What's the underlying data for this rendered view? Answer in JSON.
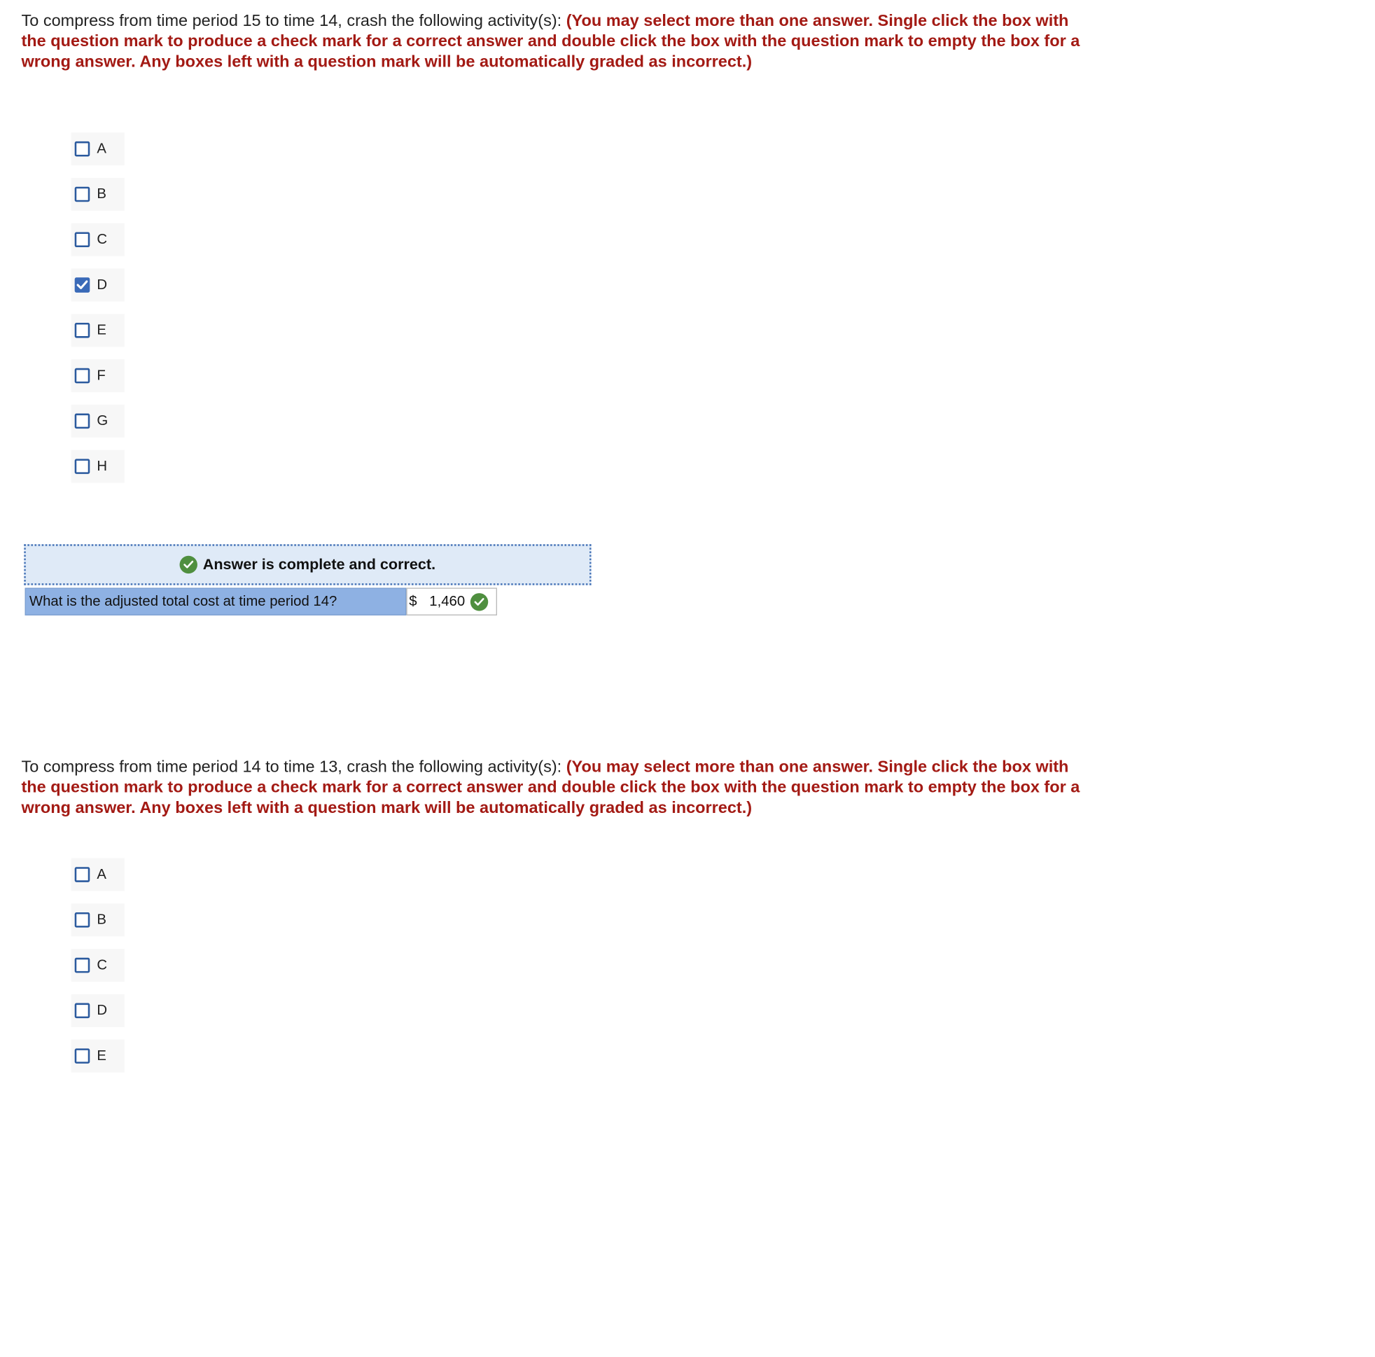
{
  "question1": {
    "lead": "To compress from time period 15 to time 14, crash the following activity(s): ",
    "instruction": "(You may select more than one answer. Single click the box with the question mark to produce a check mark for a correct answer and double click the box with the question mark to empty the box for a wrong answer. Any boxes left with a question mark will be automatically graded as incorrect.)",
    "choices": [
      {
        "label": "A",
        "checked": false
      },
      {
        "label": "B",
        "checked": false
      },
      {
        "label": "C",
        "checked": false
      },
      {
        "label": "D",
        "checked": true
      },
      {
        "label": "E",
        "checked": false
      },
      {
        "label": "F",
        "checked": false
      },
      {
        "label": "G",
        "checked": false
      },
      {
        "label": "H",
        "checked": false
      }
    ]
  },
  "result": {
    "banner_text": "Answer is complete and correct.",
    "question_text": "What is the adjusted total cost at time period 14?",
    "currency": "$",
    "value": "1,460"
  },
  "question2": {
    "lead": "To compress from time period 14 to time 13, crash the following activity(s): ",
    "instruction": "(You may select more than one answer. Single click the box with the question mark to produce a check mark for a correct answer and double click the box with the question mark to empty the box for a wrong answer. Any boxes left with a question mark will be automatically graded as incorrect.)",
    "choices": [
      {
        "label": "A",
        "checked": false
      },
      {
        "label": "B",
        "checked": false
      },
      {
        "label": "C",
        "checked": false
      },
      {
        "label": "D",
        "checked": false
      },
      {
        "label": "E",
        "checked": false
      }
    ]
  },
  "colors": {
    "instruction_red": "#a31a14",
    "checkbox_blue": "#3a6ab8",
    "banner_bg": "#dfeaf7",
    "label_bg": "#8eb1e3",
    "correct_green": "#4f8f3f"
  }
}
